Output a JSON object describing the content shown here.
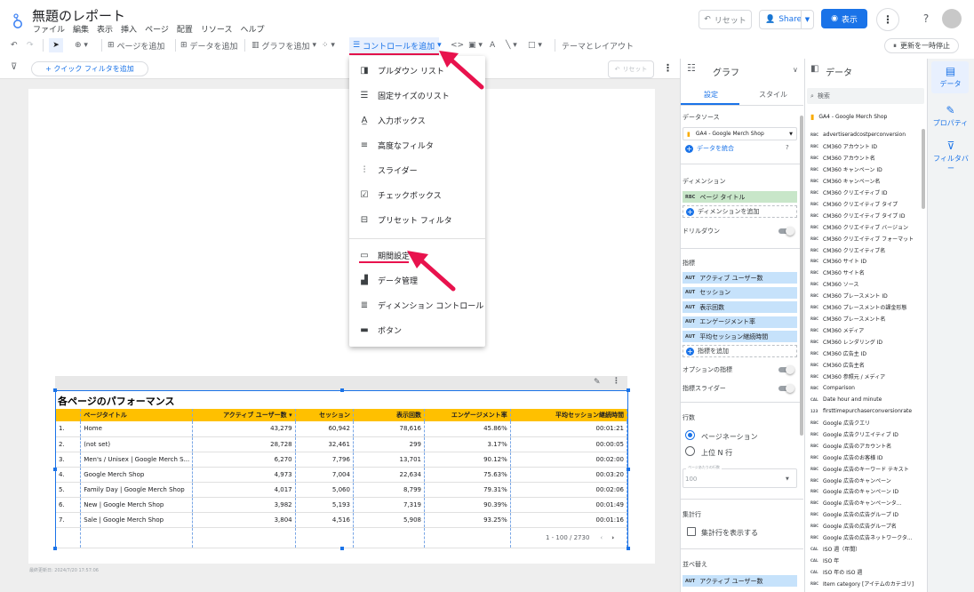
{
  "app": {
    "title": "無題のレポート",
    "menu": [
      "ファイル",
      "編集",
      "表示",
      "挿入",
      "ページ",
      "配置",
      "リソース",
      "ヘルプ"
    ],
    "reset_label": "リセット",
    "share_label": "Share",
    "view_label": "表示"
  },
  "toolbar": {
    "add_page": "ページを追加",
    "add_data": "データを追加",
    "add_chart": "グラフを追加",
    "add_control": "コントロールを追加",
    "theme_layout": "テーマとレイアウト",
    "refresh_pause": "更新を一時停止"
  },
  "filter": {
    "quick_filter": "+ クイック フィルタを追加",
    "reset_label": "リセット"
  },
  "control_menu": {
    "items": [
      {
        "icon": "dropdown-list-icon",
        "label": "プルダウン リスト"
      },
      {
        "icon": "fixed-list-icon",
        "label": "固定サイズのリスト"
      },
      {
        "icon": "input-box-icon",
        "label": "入力ボックス"
      },
      {
        "icon": "advanced-filter-icon",
        "label": "高度なフィルタ"
      },
      {
        "icon": "slider-icon",
        "label": "スライダー"
      },
      {
        "icon": "checkbox-icon",
        "label": "チェックボックス"
      },
      {
        "icon": "preset-filter-icon",
        "label": "プリセット フィルタ"
      },
      {
        "icon": "calendar-icon",
        "label": "期間設定"
      },
      {
        "icon": "data-control-icon",
        "label": "データ管理"
      },
      {
        "icon": "dimension-control-icon",
        "label": "ディメンション コントロール"
      },
      {
        "icon": "button-icon",
        "label": "ボタン"
      }
    ]
  },
  "table": {
    "title": "各ページのパフォーマンス",
    "columns": [
      "ページタイトル",
      "アクティブ ユーザー数 ▾",
      "セッション",
      "表示回数",
      "エンゲージメント率",
      "平均セッション継続時間"
    ],
    "rows": [
      [
        "1.",
        "Home",
        "43,279",
        "60,942",
        "78,616",
        "45.86%",
        "00:01:21"
      ],
      [
        "2.",
        "(not set)",
        "28,728",
        "32,461",
        "299",
        "3.17%",
        "00:00:05"
      ],
      [
        "3.",
        "Men's / Unisex | Google Merch S...",
        "6,270",
        "7,796",
        "13,701",
        "90.12%",
        "00:02:00"
      ],
      [
        "4.",
        "Google Merch Shop",
        "4,973",
        "7,004",
        "22,634",
        "75.63%",
        "00:03:20"
      ],
      [
        "5.",
        "Family Day | Google Merch Shop",
        "4,017",
        "5,060",
        "8,799",
        "79.31%",
        "00:02:06"
      ],
      [
        "6.",
        "New | Google Merch Shop",
        "3,982",
        "5,193",
        "7,319",
        "90.39%",
        "00:01:49"
      ],
      [
        "7.",
        "Sale | Google Merch Shop",
        "3,804",
        "4,516",
        "5,908",
        "93.25%",
        "00:01:16"
      ]
    ],
    "pagination": "1 - 100 / 2730"
  },
  "last_updated": "最終更新日: 2024/7/20 17:57:06",
  "chart_pane": {
    "title": "グラフ",
    "tabs": [
      "設定",
      "スタイル"
    ],
    "data_source_label": "データソース",
    "data_source": "GA4 - Google Merch Shop",
    "blend_label": "データを統合",
    "dimension_label": "ディメンション",
    "dimension": "ページ タイトル",
    "add_dimension": "ディメンションを追加",
    "drilldown": "ドリルダウン",
    "metric_label": "指標",
    "metrics": [
      "アクティブ ユーザー数",
      "セッション",
      "表示回数",
      "エンゲージメント率",
      "平均セッション継続時間"
    ],
    "add_metric": "指標を追加",
    "optional_metric": "オプションの指標",
    "metric_slider": "指標スライダー",
    "rows_label": "行数",
    "pagination": "ページネーション",
    "top_n": "上位 N 行",
    "rows_per_page_label": "ページあたりの行数",
    "rows_per_page": "100",
    "summary_label": "集計行",
    "summary_checkbox": "集計行を表示する",
    "sort_label": "並べ替え",
    "sort_metric": "アクティブ ユーザー数",
    "tag_dim": "RBC",
    "tag_metric": "AUT"
  },
  "data_pane": {
    "title": "データ",
    "search_placeholder": "検索",
    "source": "GA4 - Google Merch Shop",
    "fields": [
      {
        "tag": "RBC",
        "name": "advertiseradcostperconversion"
      },
      {
        "tag": "RBC",
        "name": "CM360 アカウント ID"
      },
      {
        "tag": "RBC",
        "name": "CM360 アカウント名"
      },
      {
        "tag": "RBC",
        "name": "CM360 キャンペーン ID"
      },
      {
        "tag": "RBC",
        "name": "CM360 キャンペーン名"
      },
      {
        "tag": "RBC",
        "name": "CM360 クリエイティブ ID"
      },
      {
        "tag": "RBC",
        "name": "CM360 クリエイティブ タイプ"
      },
      {
        "tag": "RBC",
        "name": "CM360 クリエイティブ タイプ ID"
      },
      {
        "tag": "RBC",
        "name": "CM360 クリエイティブ バージョン"
      },
      {
        "tag": "RBC",
        "name": "CM360 クリエイティブ フォーマット"
      },
      {
        "tag": "RBC",
        "name": "CM360 クリエイティブ名"
      },
      {
        "tag": "RBC",
        "name": "CM360 サイト ID"
      },
      {
        "tag": "RBC",
        "name": "CM360 サイト名"
      },
      {
        "tag": "RBC",
        "name": "CM360 ソース"
      },
      {
        "tag": "RBC",
        "name": "CM360 プレースメント ID"
      },
      {
        "tag": "RBC",
        "name": "CM360 プレースメントの課金形態"
      },
      {
        "tag": "RBC",
        "name": "CM360 プレースメント名"
      },
      {
        "tag": "RBC",
        "name": "CM360 メディア"
      },
      {
        "tag": "RBC",
        "name": "CM360 レンダリング ID"
      },
      {
        "tag": "RBC",
        "name": "CM360 広告主 ID"
      },
      {
        "tag": "RBC",
        "name": "CM360 広告主名"
      },
      {
        "tag": "RBC",
        "name": "CM360 参照元 / メディア"
      },
      {
        "tag": "RBC",
        "name": "Comparison"
      },
      {
        "tag": "CAL",
        "name": "Date hour and minute"
      },
      {
        "tag": "123",
        "name": "firsttimepurchaserconversionrate"
      },
      {
        "tag": "RBC",
        "name": "Google 広告クエリ"
      },
      {
        "tag": "RBC",
        "name": "Google 広告クリエイティブ ID"
      },
      {
        "tag": "RBC",
        "name": "Google 広告のアカウント名"
      },
      {
        "tag": "RBC",
        "name": "Google 広告のお客様 ID"
      },
      {
        "tag": "RBC",
        "name": "Google 広告のキーワード テキスト"
      },
      {
        "tag": "RBC",
        "name": "Google 広告のキャンペーン"
      },
      {
        "tag": "RBC",
        "name": "Google 広告のキャンペーン ID"
      },
      {
        "tag": "RBC",
        "name": "Google 広告のキャンペーンタ..."
      },
      {
        "tag": "RBC",
        "name": "Google 広告の広告グループ ID"
      },
      {
        "tag": "RBC",
        "name": "Google 広告の広告グループ名"
      },
      {
        "tag": "RBC",
        "name": "Google 広告の広告ネットワークタ..."
      },
      {
        "tag": "CAL",
        "name": "ISO 週（年間）"
      },
      {
        "tag": "CAL",
        "name": "ISO 年"
      },
      {
        "tag": "CAL",
        "name": "ISO 年の ISO 週"
      },
      {
        "tag": "RBC",
        "name": "Item category [アイテムのカテゴリ]"
      }
    ]
  },
  "rail": {
    "data": "データ",
    "properties": "プロパティ",
    "filter": "フィルタバー"
  },
  "colors": {
    "accent": "#1a73e8",
    "arrow": "#e8124d",
    "table_header": "#ffc000"
  }
}
